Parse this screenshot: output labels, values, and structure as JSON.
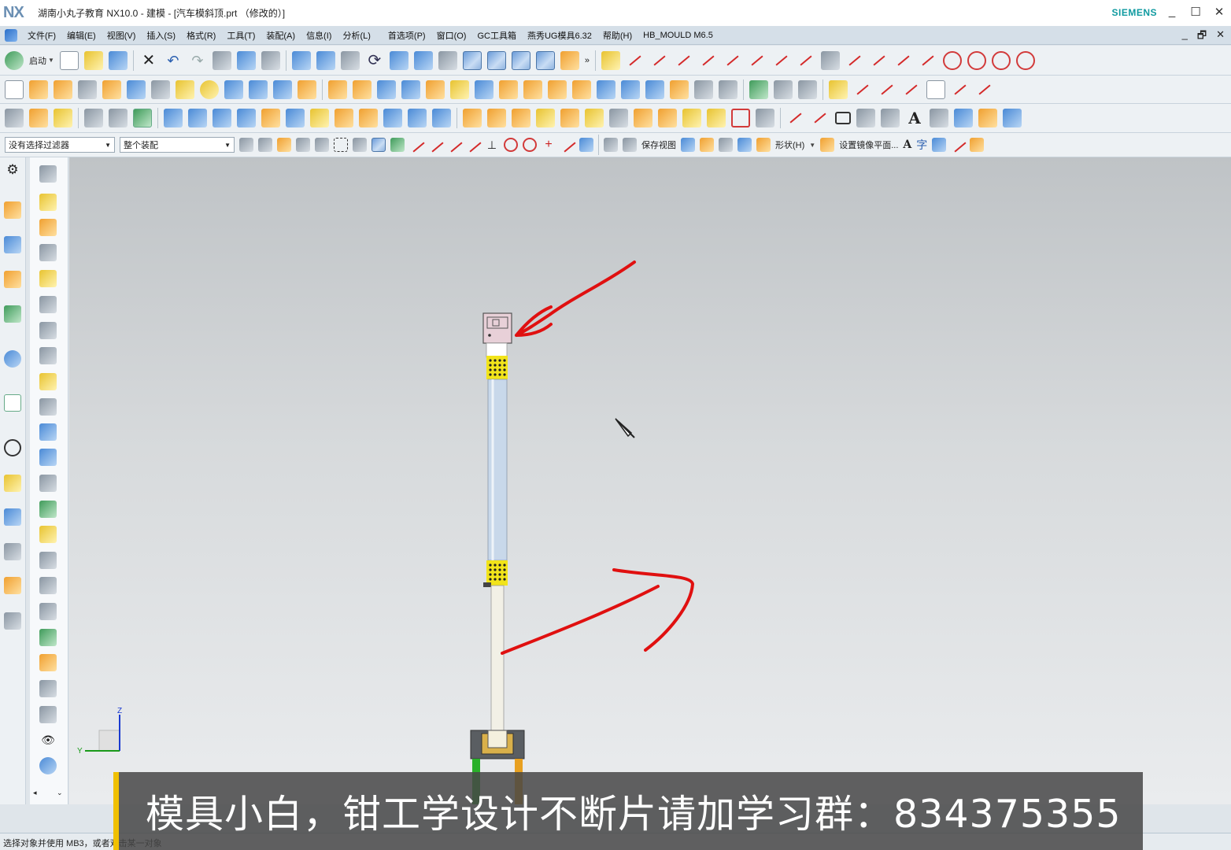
{
  "window": {
    "app_logo": "NX",
    "title": "湖南小丸子教育 NX10.0 - 建模 - [汽车模斜顶.prt （修改的）]",
    "brand": "SIEMENS",
    "minimize": "_",
    "maximize": "☐",
    "close": "✕"
  },
  "menubar": {
    "items": [
      "文件(F)",
      "编辑(E)",
      "视图(V)",
      "插入(S)",
      "格式(R)",
      "工具(T)",
      "装配(A)",
      "信息(I)",
      "分析(L)",
      "首选项(P)",
      "窗口(O)",
      "GC工具箱",
      "燕秀UG模具6.32",
      "帮助(H)",
      "HB_MOULD M6.5"
    ],
    "doc_minimize": "_",
    "doc_restore": "🗗",
    "doc_close": "✕"
  },
  "toolbar1": {
    "start_label": "启动",
    "more": "»"
  },
  "toolbar4": {
    "selection_filter": "没有选择过滤器",
    "assembly_scope": "整个装配",
    "save_view": "保存视图",
    "shape_menu": "形状(H)",
    "mirror_plane": "设置镜像平面...",
    "text_a": "A",
    "text_zi": "字"
  },
  "viewport": {
    "triad_z": "Z",
    "triad_y": "Y",
    "colors": {
      "background_top": "#bfc3c6",
      "background_bottom": "#eaecee",
      "annotation": "#e01010",
      "spring": "#f2e41a",
      "rod": "#c8d8ea",
      "slider_head": "#e8d0d8",
      "base_block": "#5a5e62",
      "green_guide": "#2ab02a"
    }
  },
  "statusbar": {
    "prompt": "选择对象并使用 MB3，或者双击某一对象"
  },
  "subtitle": {
    "text": "模具小白，钳工学设计不断片请加学习群：834375355"
  }
}
